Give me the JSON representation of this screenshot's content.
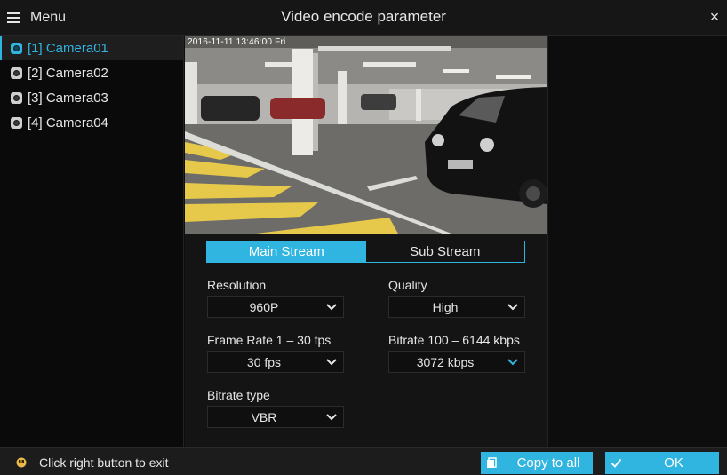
{
  "titlebar": {
    "menu_label": "Menu",
    "title": "Video encode parameter",
    "close_glyph": "×"
  },
  "sidebar": {
    "items": [
      {
        "label": "[1] Camera01",
        "active": true
      },
      {
        "label": "[2] Camera02",
        "active": false
      },
      {
        "label": "[3] Camera03",
        "active": false
      },
      {
        "label": "[4] Camera04",
        "active": false
      }
    ]
  },
  "preview": {
    "osd_text": "2016-11-11  13:46:00  Fri"
  },
  "tabs": {
    "main_stream": "Main Stream",
    "sub_stream": "Sub Stream",
    "selected": "main_stream"
  },
  "form": {
    "resolution": {
      "label": "Resolution",
      "value": "960P"
    },
    "quality": {
      "label": "Quality",
      "value": "High"
    },
    "frame_rate": {
      "label": "Frame Rate 1 – 30 fps",
      "value": "30 fps"
    },
    "bitrate": {
      "label": "Bitrate 100 – 6144 kbps",
      "value": "3072 kbps"
    },
    "bitrate_type": {
      "label": "Bitrate type",
      "value": "VBR"
    }
  },
  "status": {
    "hint": "Click right button to exit"
  },
  "buttons": {
    "copy_to_all": "Copy to all",
    "ok": "OK"
  },
  "colors": {
    "accent": "#2fb5e0",
    "background": "#0d0d0d"
  },
  "icons": {
    "menu": "hamburger-icon",
    "close": "close-icon",
    "camera": "camera-icon",
    "dropdown": "chevron-down-icon",
    "mouse": "mouse-icon",
    "copy": "copy-icon",
    "ok": "check-icon"
  }
}
